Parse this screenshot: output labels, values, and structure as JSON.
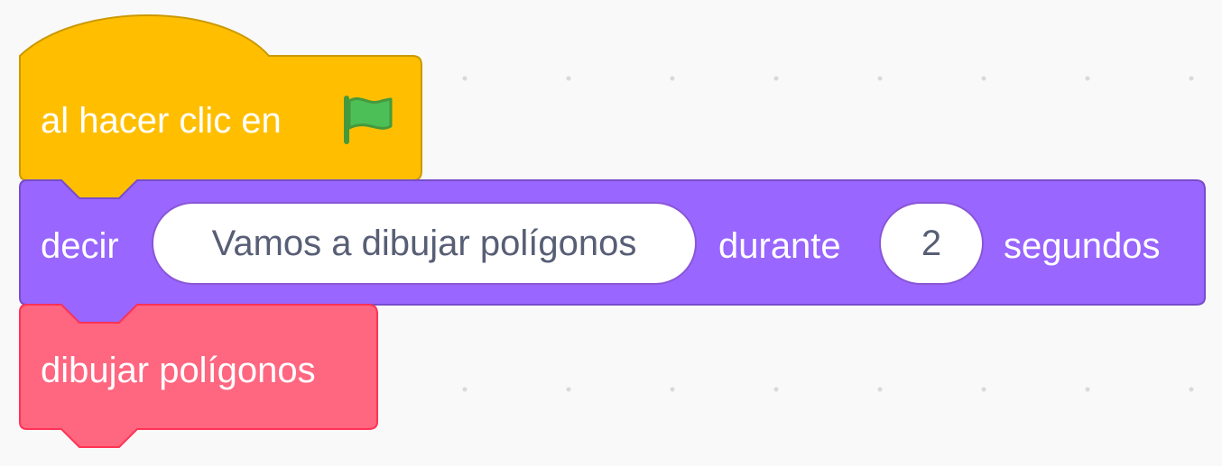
{
  "blocks": {
    "hat": {
      "label": "al hacer clic en",
      "icon": "green-flag-icon",
      "color": "#ffbf00",
      "border_color": "#cc9900"
    },
    "say": {
      "label_prefix": "decir",
      "message": "Vamos a dibujar polígonos",
      "label_middle": "durante",
      "seconds": "2",
      "label_suffix": "segundos",
      "color": "#9966ff",
      "border_color": "#774dcb"
    },
    "custom": {
      "label": "dibujar polígonos",
      "color": "#ff6680",
      "border_color": "#ff3355"
    }
  },
  "colors": {
    "workspace_background": "#f9f9f9",
    "grid_dot": "#d9d9d9",
    "flag_green": "#4cbf56"
  }
}
